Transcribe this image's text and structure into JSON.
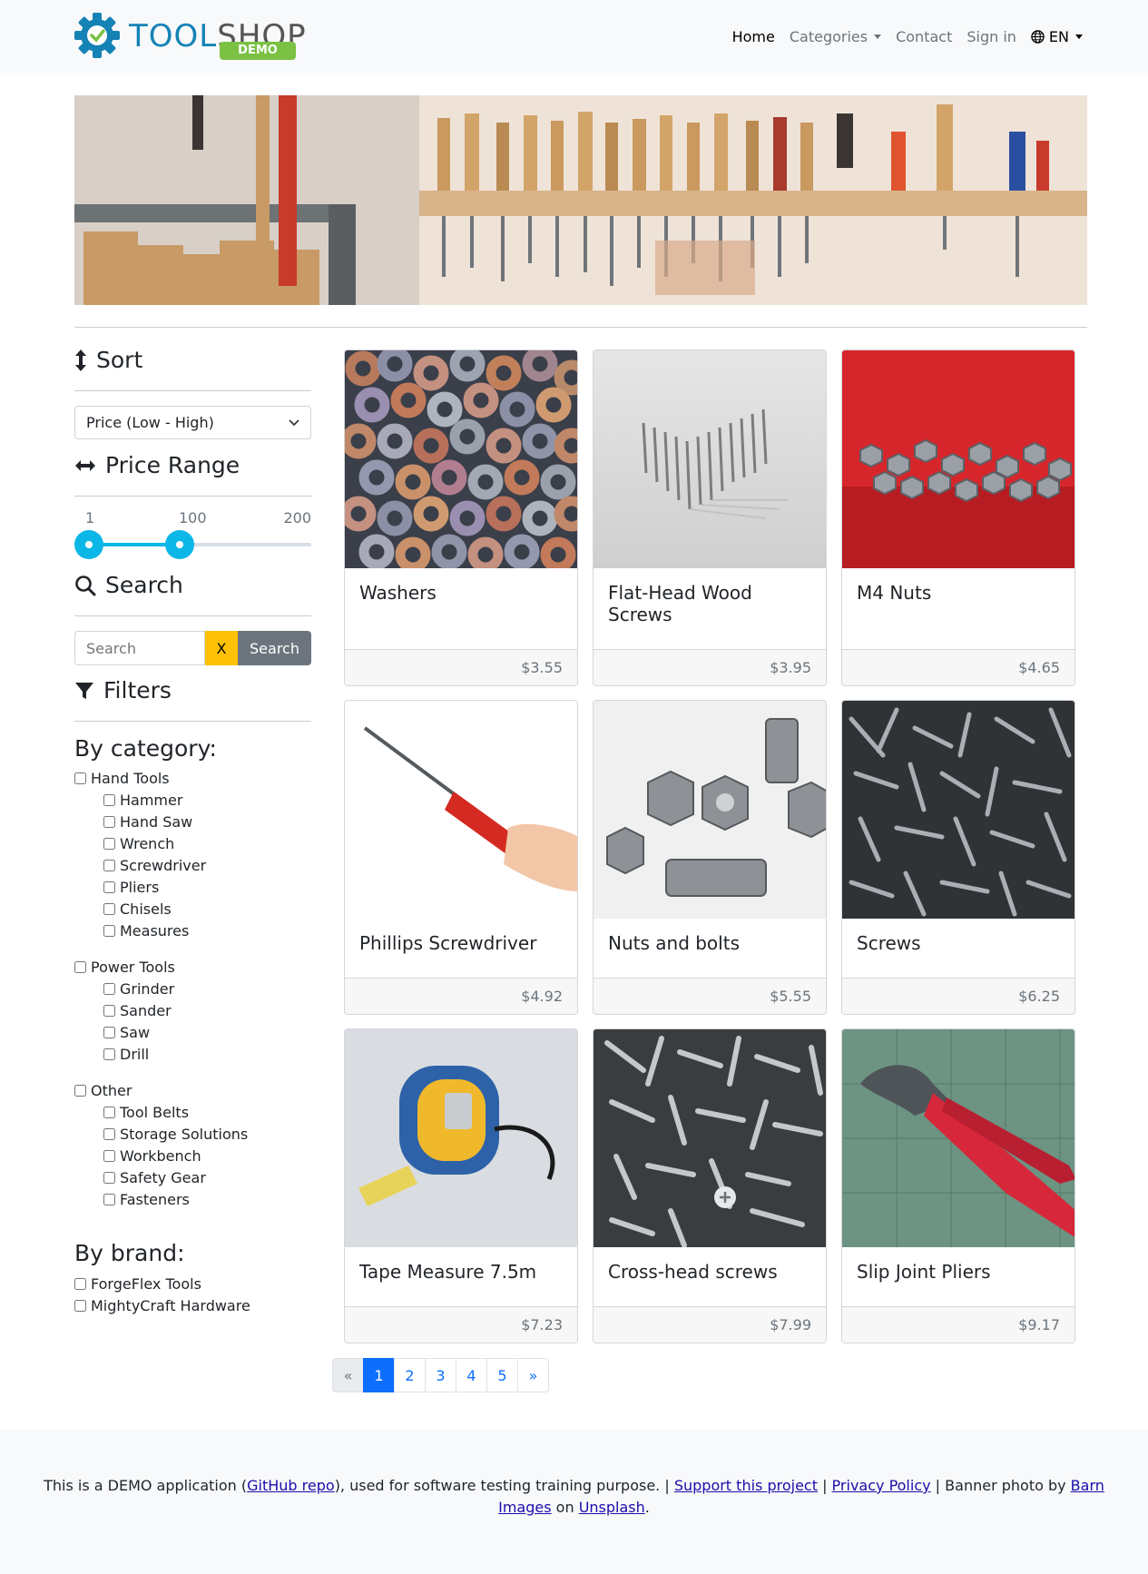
{
  "brand": {
    "name_part1": "TOOL",
    "name_part2": "SHOP",
    "badge": "DEMO"
  },
  "nav": {
    "home": "Home",
    "categories": "Categories",
    "contact": "Contact",
    "sign_in": "Sign in",
    "language": "EN"
  },
  "sidebar": {
    "sort_title": "Sort",
    "sort_value": "Price (Low - High)",
    "price_title": "Price Range",
    "slider": {
      "min_label": "1",
      "mid_label": "100",
      "max_label": "200",
      "range_min": 1,
      "range_max": 200,
      "low": 1,
      "high": 100
    },
    "search_title": "Search",
    "search_placeholder": "Search",
    "clear_label": "X",
    "search_button": "Search",
    "filters_title": "Filters",
    "by_category": "By category:",
    "groups": [
      {
        "label": "Hand Tools",
        "items": [
          "Hammer",
          "Hand Saw",
          "Wrench",
          "Screwdriver",
          "Pliers",
          "Chisels",
          "Measures"
        ]
      },
      {
        "label": "Power Tools",
        "items": [
          "Grinder",
          "Sander",
          "Saw",
          "Drill"
        ]
      },
      {
        "label": "Other",
        "items": [
          "Tool Belts",
          "Storage Solutions",
          "Workbench",
          "Safety Gear",
          "Fasteners"
        ]
      }
    ],
    "by_brand": "By brand:",
    "brands": [
      "ForgeFlex Tools",
      "MightyCraft Hardware"
    ]
  },
  "products": [
    {
      "name": "Washers",
      "price": "$3.55"
    },
    {
      "name": "Flat-Head Wood Screws",
      "price": "$3.95"
    },
    {
      "name": "M4 Nuts",
      "price": "$4.65"
    },
    {
      "name": "Phillips Screwdriver",
      "price": "$4.92"
    },
    {
      "name": "Nuts and bolts",
      "price": "$5.55"
    },
    {
      "name": "Screws",
      "price": "$6.25"
    },
    {
      "name": "Tape Measure 7.5m",
      "price": "$7.23"
    },
    {
      "name": "Cross-head screws",
      "price": "$7.99"
    },
    {
      "name": "Slip Joint Pliers",
      "price": "$9.17"
    }
  ],
  "pagination": {
    "prev": "«",
    "pages": [
      "1",
      "2",
      "3",
      "4",
      "5"
    ],
    "next": "»",
    "current": "1"
  },
  "footer": {
    "t1": "This is a DEMO application (",
    "l1": "GitHub repo",
    "t2": "), used for software testing training purpose. | ",
    "l2": "Support this project",
    "t3": " | ",
    "l3": "Privacy Policy",
    "t4": " | Banner photo by ",
    "l4": "Barn Images",
    "t5": " on ",
    "l5": "Unsplash",
    "t6": "."
  },
  "colors": {
    "accent": "#0bb7e6",
    "primary": "#0d6efd",
    "warning": "#ffc107",
    "secondary": "#6c757d"
  }
}
